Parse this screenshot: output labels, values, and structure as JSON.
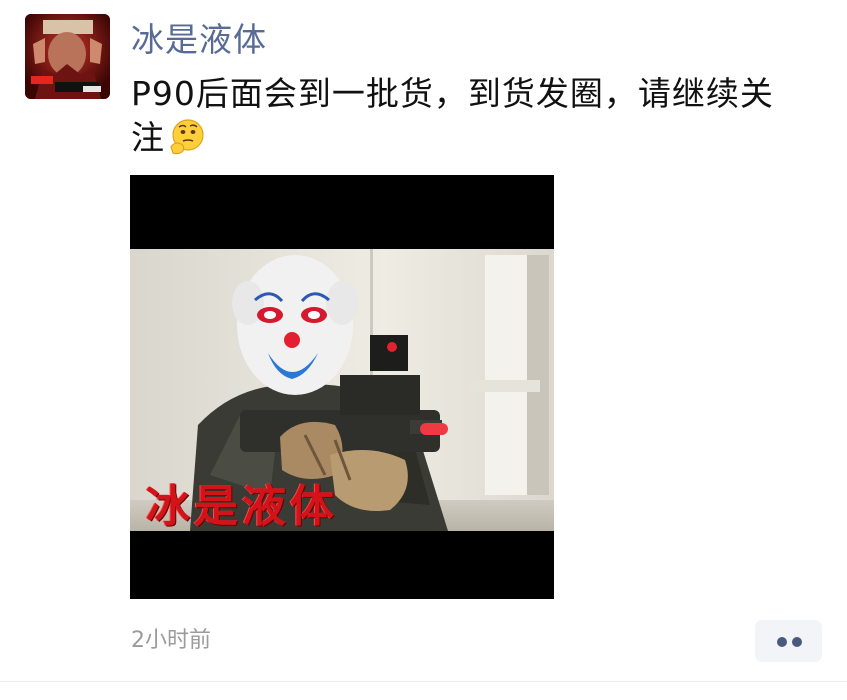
{
  "post": {
    "author": "冰是液体",
    "content": "P90后面会到一批货，到货发圈，请继续关注",
    "content_emoji": "thinking-face-emoji",
    "image_watermark": "冰是液体",
    "time": "2小时前",
    "more_button": "more-options"
  },
  "colors": {
    "author_name": "#576b95",
    "text": "#111111",
    "timestamp": "#9b9b9b",
    "watermark": "#d2141a",
    "more_button_bg": "#f3f4f8"
  }
}
